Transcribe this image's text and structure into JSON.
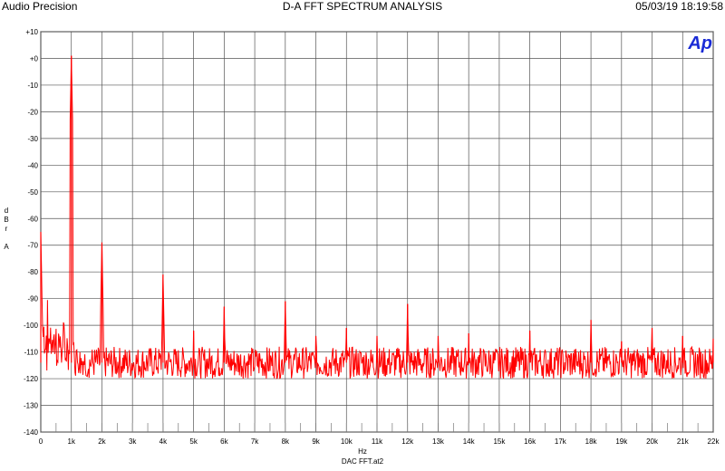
{
  "header": {
    "left": "Audio Precision",
    "center": "D-A FFT SPECTRUM ANALYSIS",
    "right": "05/03/19 18:19:58"
  },
  "logo_text": "Ap",
  "footnote": "DAC FFT.at2",
  "chart_data": {
    "type": "line",
    "title": "D-A FFT SPECTRUM ANALYSIS",
    "xlabel": "Hz",
    "ylabel_lines": [
      "d",
      "B",
      "r",
      "",
      "A"
    ],
    "xlim": [
      0,
      22000
    ],
    "ylim": [
      -140,
      10
    ],
    "grid": true,
    "x_ticks": [
      0,
      1000,
      2000,
      3000,
      4000,
      5000,
      6000,
      7000,
      8000,
      9000,
      10000,
      11000,
      12000,
      13000,
      14000,
      15000,
      16000,
      17000,
      18000,
      19000,
      20000,
      21000,
      22000
    ],
    "x_tick_labels": [
      "0",
      "1k",
      "2k",
      "3k",
      "4k",
      "5k",
      "6k",
      "7k",
      "8k",
      "9k",
      "10k",
      "11k",
      "12k",
      "13k",
      "14k",
      "15k",
      "16k",
      "17k",
      "18k",
      "19k",
      "20k",
      "21k",
      "22k"
    ],
    "y_ticks": [
      10,
      0,
      -10,
      -20,
      -30,
      -40,
      -50,
      -60,
      -70,
      -80,
      -90,
      -100,
      -110,
      -120,
      -130,
      -140
    ],
    "y_tick_labels": [
      "+10",
      "+0",
      "-10",
      "-20",
      "-30",
      "-40",
      "-50",
      "-60",
      "-70",
      "-80",
      "-90",
      "-100",
      "-110",
      "-120",
      "-130",
      "-140"
    ],
    "line_color": "#ff0000",
    "noise_floor_db": -114,
    "peaks": [
      {
        "x": 0,
        "y": -65
      },
      {
        "x": 1000,
        "y": 1
      },
      {
        "x": 2000,
        "y": -69
      },
      {
        "x": 4000,
        "y": -81
      },
      {
        "x": 5000,
        "y": -102
      },
      {
        "x": 6000,
        "y": -93
      },
      {
        "x": 8000,
        "y": -91
      },
      {
        "x": 9000,
        "y": -104
      },
      {
        "x": 10000,
        "y": -101
      },
      {
        "x": 11000,
        "y": -104
      },
      {
        "x": 12000,
        "y": -92
      },
      {
        "x": 13000,
        "y": -104
      },
      {
        "x": 14000,
        "y": -103
      },
      {
        "x": 16000,
        "y": -102
      },
      {
        "x": 18000,
        "y": -98
      },
      {
        "x": 19000,
        "y": -106
      },
      {
        "x": 20000,
        "y": -101
      },
      {
        "x": 21000,
        "y": -104
      },
      {
        "x": 22000,
        "y": -105
      }
    ]
  }
}
